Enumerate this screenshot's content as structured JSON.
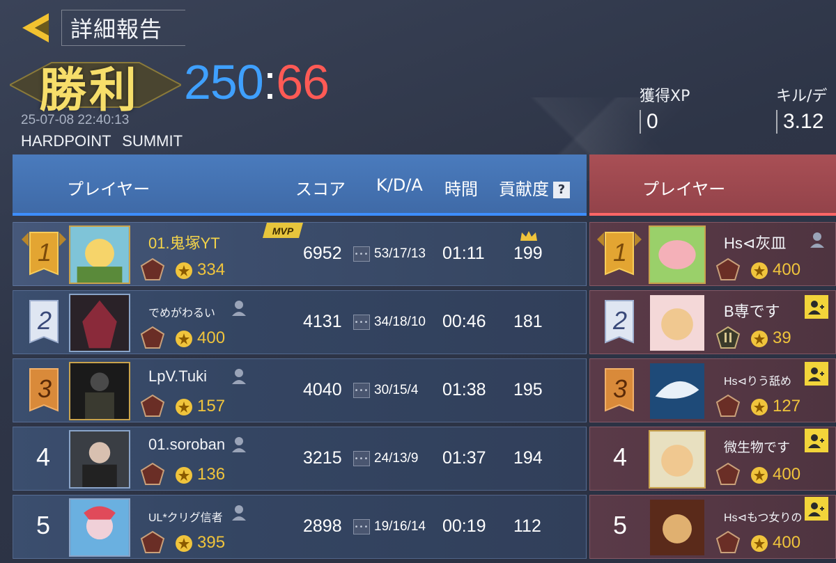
{
  "header": {
    "title": "詳細報告",
    "result": "勝利",
    "score_blue": "250",
    "score_sep": ":",
    "score_red": "66",
    "datetime": "25-07-08 22:40:13",
    "mode": "HARDPOINT",
    "map": "SUMMIT"
  },
  "stats": {
    "xp_label": "獲得XP",
    "xp_value": "0",
    "kd_label": "キル/デ",
    "kd_value": "3.12"
  },
  "columns": {
    "player": "プレイヤー",
    "score": "スコア",
    "kda": "K/D/A",
    "time": "時間",
    "contribution": "貢献度",
    "help": "?"
  },
  "badges": {
    "mvp": "MVP"
  },
  "blue_team": [
    {
      "rank": "1",
      "name": "01.鬼塚YT",
      "level": "334",
      "score": "6952",
      "kda": "53/17/13",
      "time": "01:11",
      "contribution": "199"
    },
    {
      "rank": "2",
      "name": "でめがわるい",
      "level": "400",
      "score": "4131",
      "kda": "34/18/10",
      "time": "00:46",
      "contribution": "181"
    },
    {
      "rank": "3",
      "name": "LpV.Tuki",
      "level": "157",
      "score": "4040",
      "kda": "30/15/4",
      "time": "01:38",
      "contribution": "195"
    },
    {
      "rank": "4",
      "name": "01.soroban",
      "level": "136",
      "score": "3215",
      "kda": "24/13/9",
      "time": "01:37",
      "contribution": "194"
    },
    {
      "rank": "5",
      "name": "UL*クリグ信者",
      "level": "395",
      "score": "2898",
      "kda": "19/16/14",
      "time": "00:19",
      "contribution": "112"
    }
  ],
  "red_team": [
    {
      "rank": "1",
      "name": "Hs⊲灰皿",
      "level": "400"
    },
    {
      "rank": "2",
      "name": "B専です",
      "level": "39"
    },
    {
      "rank": "3",
      "name": "Hs⊲りう舐め",
      "level": "127"
    },
    {
      "rank": "4",
      "name": "微生物です",
      "level": "400"
    },
    {
      "rank": "5",
      "name": "Hs⊲もつ女りの",
      "level": "400"
    }
  ],
  "colors": {
    "blue_accent": "#3fa0ff",
    "red_accent": "#ff5a55",
    "gold": "#f3d34a",
    "level": "#f0c43c"
  },
  "icons": [
    "back-arrow-icon",
    "help-icon",
    "friend-icon",
    "add-friend-icon",
    "star-icon",
    "rank-emblem-icon",
    "crown-icon",
    "kda-detail-icon"
  ]
}
